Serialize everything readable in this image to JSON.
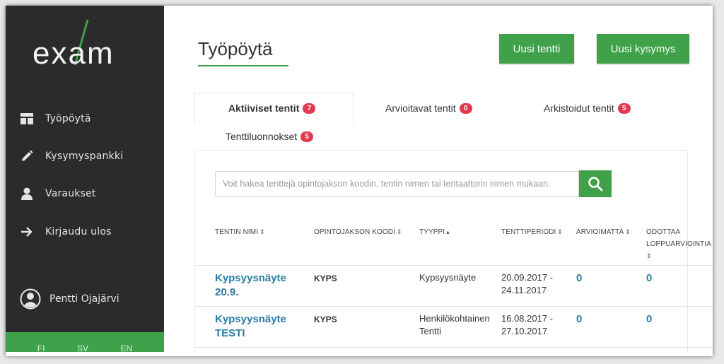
{
  "app": {
    "logo_text": "exam"
  },
  "sidebar": {
    "items": [
      {
        "label": "Työpöytä",
        "icon": "dashboard-icon"
      },
      {
        "label": "Kysymyspankki",
        "icon": "pencil-icon"
      },
      {
        "label": "Varaukset",
        "icon": "user-icon"
      },
      {
        "label": "Kirjaudu ulos",
        "icon": "arrow-right-icon"
      }
    ],
    "user_name": "Pentti Ojajärvi",
    "languages": [
      "FI",
      "SV",
      "EN"
    ]
  },
  "header": {
    "title": "Työpöytä",
    "new_exam_label": "Uusi tentti",
    "new_question_label": "Uusi kysymys"
  },
  "tabs": [
    {
      "label": "Aktiiviset tentit",
      "count": "7",
      "active": true
    },
    {
      "label": "Arvioitavat tentit",
      "count": "0"
    },
    {
      "label": "Arkistoidut tentit",
      "count": "5"
    },
    {
      "label": "Tenttiluonnokset",
      "count": "5"
    }
  ],
  "search": {
    "placeholder": "Voit hakea tenttejä opintojakson koodin, tentin nimen tai tentaattorin nimen mukaan."
  },
  "table": {
    "columns": [
      {
        "label": "TENTIN NIMI",
        "sort": "⇕"
      },
      {
        "label": "OPINTOJAKSON KOODI",
        "sort": "⇕"
      },
      {
        "label": "TYYPPI",
        "sort": "▴"
      },
      {
        "label": "TENTTIPERIODI",
        "sort": "⇕"
      },
      {
        "label": "ARVIOIMATTA",
        "sort": "⇕"
      },
      {
        "label": "ODOTTAA",
        "label2": "LOPPUARVIOINTIA",
        "sort": "⇕"
      }
    ],
    "rows": [
      {
        "name_line1": "Kypsyysnäyte",
        "name_line2": "20.9.",
        "code": "KYPS",
        "type_line1": "Kypsyysnäyte",
        "type_line2": "",
        "period_line1": "20.09.2017 -",
        "period_line2": "24.11.2017",
        "unassessed": "0",
        "awaiting": "0"
      },
      {
        "name_line1": "Kypsyysnäyte",
        "name_line2": "TESTI",
        "code": "KYPS",
        "type_line1": "Henkilökohtainen",
        "type_line2": "Tentti",
        "period_line1": "16.08.2017 -",
        "period_line2": "27.10.2017",
        "unassessed": "0",
        "awaiting": "0"
      }
    ]
  },
  "colors": {
    "accent": "#3fa14a",
    "sidebar": "#2b2b2b",
    "badge": "#e03a4e",
    "link": "#2b7ca3"
  }
}
